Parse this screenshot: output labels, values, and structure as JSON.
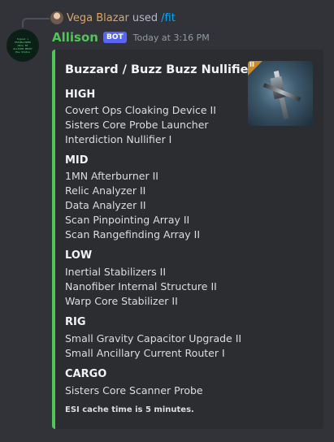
{
  "reply": {
    "user": "Vega Blazar",
    "used": "used",
    "command": "/fit"
  },
  "message": {
    "username": "Allison",
    "bot_tag": "BOT",
    "timestamp": "Today at 3:16 PM"
  },
  "avatar_text": [
    "Signal v",
    "ESTABLISHED",
    "mPow 83",
    "ALLISON READY",
    "Pow Status"
  ],
  "embed": {
    "accent_color": "#53c35a",
    "title": "Buzzard / Buzz Buzz Nullified",
    "thumbnail_badge": "II",
    "sections": [
      {
        "heading": "HIGH",
        "items": [
          "Covert Ops Cloaking Device II",
          "Sisters Core Probe Launcher",
          "Interdiction Nullifier I"
        ]
      },
      {
        "heading": "MID",
        "items": [
          "1MN Afterburner II",
          "Relic Analyzer II",
          "Data Analyzer II",
          "Scan Pinpointing Array II",
          "Scan Rangefinding Array II"
        ]
      },
      {
        "heading": "LOW",
        "items": [
          "Inertial Stabilizers II",
          "Nanofiber Internal Structure II",
          "Warp Core Stabilizer II"
        ]
      },
      {
        "heading": "RIG",
        "items": [
          "Small Gravity Capacitor Upgrade II",
          "Small Ancillary Current Router I"
        ]
      },
      {
        "heading": "CARGO",
        "items": [
          "Sisters Core Scanner Probe"
        ]
      }
    ],
    "footer": "ESI cache time is 5 minutes."
  }
}
